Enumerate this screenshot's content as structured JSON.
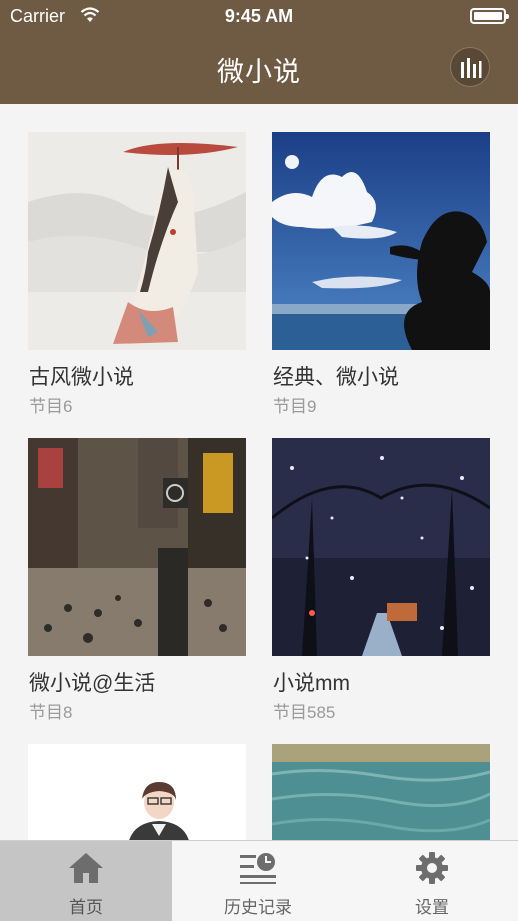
{
  "status_bar": {
    "carrier": "Carrier",
    "time": "9:45 AM"
  },
  "nav": {
    "title": "微小说"
  },
  "programs": [
    {
      "title": "古风微小说",
      "count": "节目6"
    },
    {
      "title": "经典、微小说",
      "count": "节目9"
    },
    {
      "title": "微小说@生活",
      "count": "节目8"
    },
    {
      "title": "小说mm",
      "count": "节目585"
    },
    {
      "title": "",
      "count": ""
    },
    {
      "title": "",
      "count": ""
    }
  ],
  "tabs": [
    {
      "label": "首页",
      "icon": "home-icon",
      "active": true
    },
    {
      "label": "历史记录",
      "icon": "history-icon",
      "active": false
    },
    {
      "label": "设置",
      "icon": "gear-icon",
      "active": false
    }
  ],
  "colors": {
    "header": "#6f5b44",
    "background": "#f4f4f4",
    "active_tab": "#c5c5c5"
  }
}
